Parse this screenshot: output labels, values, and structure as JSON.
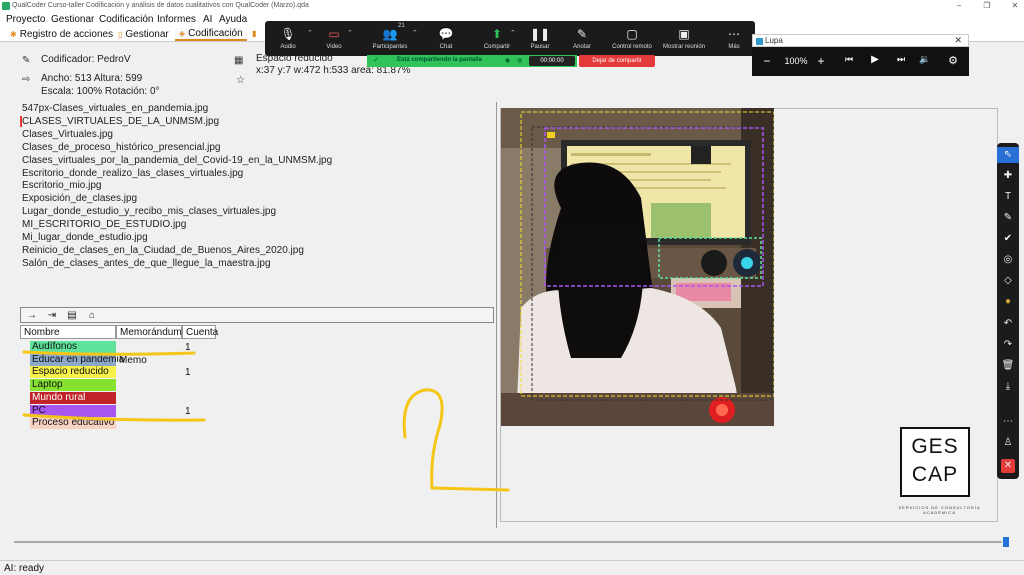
{
  "window": {
    "title": "QualCoder Curso-taller Codificación y análisis de datos cualitativos con QualCoder (Marzo).qda",
    "buttons": [
      "–",
      "❐",
      "✕"
    ]
  },
  "menu": [
    "Proyecto",
    "Gestionar",
    "Codificación",
    "Informes",
    "AI",
    "Ayuda"
  ],
  "tabs": [
    {
      "label": "Registro de acciones",
      "active": false
    },
    {
      "label": "Gestionar",
      "active": false
    },
    {
      "label": "Codificación",
      "active": true
    }
  ],
  "info": {
    "coder": "Codificador: PedroV",
    "size": "Ancho: 513 Altura: 599",
    "scale": "Escala: 100% Rotación: 0°",
    "selected_code": "Espacio reducido",
    "area": "x:37 y:7 w:472 h:533 area: 81.87%"
  },
  "files": [
    "547px-Clases_virtuales_en_pandemia.jpg",
    "CLASES_VIRTUALES_DE_LA_UNMSM.jpg",
    "Clases_Virtuales.jpg",
    "Clases_de_proceso_histórico_presencial.jpg",
    "Clases_virtuales_por_la_pandemia_del_Covid-19_en_la_UNMSM.jpg",
    "Escritorio_donde_realizo_las_clases_virtuales.jpg",
    "Escritorio_mio.jpg",
    "Exposición_de_clases.jpg",
    "Lugar_donde_estudio_y_recibo_mis_clases_virtuales.jpg",
    "MI_ESCRITORIO_DE_ESTUDIO.jpg",
    "Mi_lugar_donde_estudio.jpg",
    "Reinicio_de_clases_en_la_Ciudad_de_Buenos_Aires_2020.jpg",
    "Salón_de_clases_antes_de_que_llegue_la_maestra.jpg"
  ],
  "code_toolbar": [
    "→",
    "⇥",
    "▤",
    "⌂"
  ],
  "code_table": {
    "headers": [
      "Nombre",
      "Memorándum",
      "Cuenta"
    ],
    "rows": [
      {
        "name": "Audífonos",
        "color": "#5fe39a",
        "memo": "",
        "count": "1"
      },
      {
        "name": "Educar en pandemia",
        "color": "#8ca8c8",
        "memo": "Memo",
        "count": ""
      },
      {
        "name": "Espacio reducido",
        "color": "#f5f04a",
        "memo": "",
        "count": "1"
      },
      {
        "name": "Laptop",
        "color": "#86e22e",
        "memo": "",
        "count": ""
      },
      {
        "name": "Mundo rural",
        "color": "#c0242a",
        "memo": "",
        "count": ""
      },
      {
        "name": "PC",
        "color": "#a855f0",
        "memo": "",
        "count": "1"
      },
      {
        "name": "Proceso educativo",
        "color": "#f6d2c2",
        "memo": "",
        "count": ""
      }
    ]
  },
  "zoom_toolbar": [
    {
      "label": "Audio",
      "icon": "microphone-icon"
    },
    {
      "label": "Video",
      "icon": "video-off-icon"
    },
    {
      "label": "Participantes",
      "icon": "participants-icon",
      "badge": "21"
    },
    {
      "label": "Chat",
      "icon": "chat-icon"
    },
    {
      "label": "Compartir",
      "icon": "share-icon"
    },
    {
      "label": "Pausar",
      "icon": "pause-icon"
    },
    {
      "label": "Anotar",
      "icon": "pencil-icon"
    },
    {
      "label": "Control remoto",
      "icon": "mouse-icon"
    },
    {
      "label": "Mostrar reunión",
      "icon": "meeting-icon"
    },
    {
      "label": "Más",
      "icon": "more-icon"
    }
  ],
  "share_bar": {
    "status": "Está compartiendo la pantalla",
    "timer": "00:00:00",
    "stop": "Dejar de compartir"
  },
  "lupa": {
    "title": "Lupa",
    "zoom": "100%"
  },
  "logo": {
    "line1": "GES",
    "line2": "CAP",
    "sub": "SERVICIOS DE CONSULTORÍA ACADÉMICA"
  },
  "annotation": {
    "number": "2",
    "ink_color": "#f5c518"
  },
  "status": "AI: ready",
  "colors": {
    "accent": "#e08a1e",
    "share_green": "#2fc35a",
    "stop_red": "#e43a3a",
    "annot_yellow": "#f5c518"
  }
}
